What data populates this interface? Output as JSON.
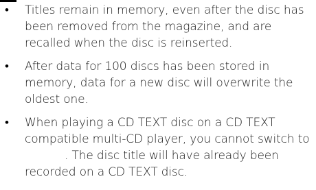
{
  "notes": {
    "bullet_symbol": "•",
    "items": [
      {
        "text": "Titles remain in memory, even after the disc has been removed from the magazine, and are recalled when the disc is reinserted."
      },
      {
        "text": "After data for 100 discs has been stored in memory, data for a new disc will overwrite the oldest one."
      },
      {
        "text_before_gap": "When playing a CD TEXT disc on a CD TEXT compatible multi-CD player, you cannot switch to",
        "text_after_gap": ". The disc title will have already been recorded on a CD TEXT disc."
      }
    ]
  }
}
